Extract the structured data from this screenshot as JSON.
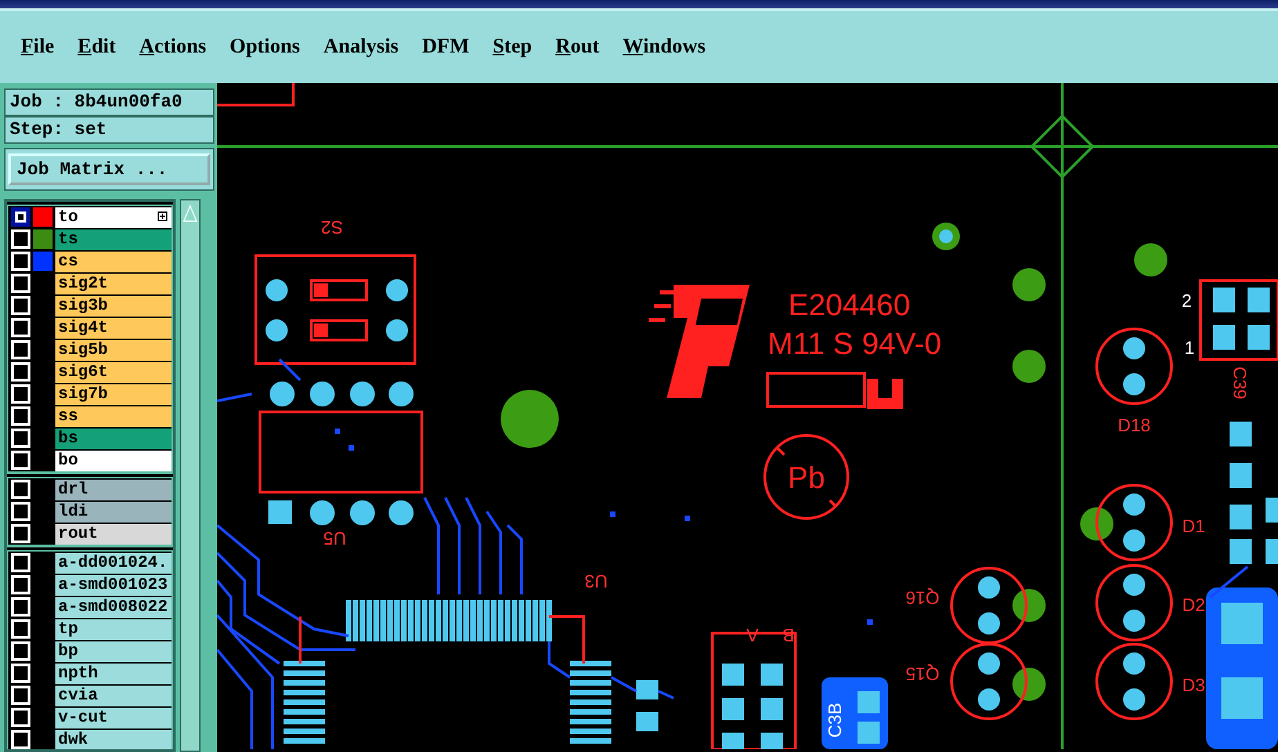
{
  "menu": [
    {
      "label": "File",
      "underlined": true
    },
    {
      "label": "Edit",
      "underlined": true
    },
    {
      "label": "Actions",
      "underlined": true
    },
    {
      "label": "Options",
      "underlined": false
    },
    {
      "label": "Analysis",
      "underlined": false
    },
    {
      "label": "DFM",
      "underlined": false
    },
    {
      "label": "Step",
      "underlined": true
    },
    {
      "label": "Rout",
      "underlined": true
    },
    {
      "label": "Windows",
      "underlined": true
    }
  ],
  "job": "Job : 8b4un00fa0",
  "step": "Step: set",
  "job_matrix_button": "Job Matrix ...",
  "layer_groups": [
    {
      "layers": [
        {
          "name": "to",
          "kind": "overlay",
          "color": "#ff0000",
          "selected": true
        },
        {
          "name": "ts",
          "kind": "mask",
          "color": "#3c8c14",
          "selected": false
        },
        {
          "name": "cs",
          "kind": "signal",
          "color": "#0033ff",
          "selected": false
        },
        {
          "name": "sig2t",
          "kind": "signal",
          "selected": false
        },
        {
          "name": "sig3b",
          "kind": "signal",
          "selected": false
        },
        {
          "name": "sig4t",
          "kind": "signal",
          "selected": false
        },
        {
          "name": "sig5b",
          "kind": "signal",
          "selected": false
        },
        {
          "name": "sig6t",
          "kind": "signal",
          "selected": false
        },
        {
          "name": "sig7b",
          "kind": "signal",
          "selected": false
        },
        {
          "name": "ss",
          "kind": "signal",
          "selected": false
        },
        {
          "name": "bs",
          "kind": "mask",
          "selected": false
        },
        {
          "name": "bo",
          "kind": "overlay",
          "selected": false
        }
      ]
    },
    {
      "layers": [
        {
          "name": "drl",
          "kind": "drill",
          "selected": false
        },
        {
          "name": "ldi",
          "kind": "drill",
          "selected": false
        },
        {
          "name": "rout",
          "kind": "rout",
          "selected": false
        }
      ]
    },
    {
      "layers": [
        {
          "name": "a-dd001024.",
          "kind": "misc",
          "selected": false
        },
        {
          "name": "a-smd001023",
          "kind": "misc",
          "selected": false
        },
        {
          "name": "a-smd008022",
          "kind": "misc",
          "selected": false
        },
        {
          "name": "tp",
          "kind": "misc",
          "selected": false
        },
        {
          "name": "bp",
          "kind": "misc",
          "selected": false
        },
        {
          "name": "npth",
          "kind": "misc",
          "selected": false
        },
        {
          "name": "cvia",
          "kind": "misc",
          "selected": false
        },
        {
          "name": "v-cut",
          "kind": "misc",
          "selected": false
        },
        {
          "name": "dwk",
          "kind": "misc",
          "selected": false
        }
      ]
    }
  ],
  "canvas": {
    "marking_lines": [
      "E204460",
      "M11 S 94V-0"
    ],
    "pb_mark": "Pb",
    "labels": [
      "S2",
      "2",
      "1",
      "C39",
      "D18",
      "D1",
      "U5",
      "U3",
      "Q16",
      "D2",
      "A",
      "B",
      "Q15",
      "D3",
      "C3B"
    ]
  }
}
